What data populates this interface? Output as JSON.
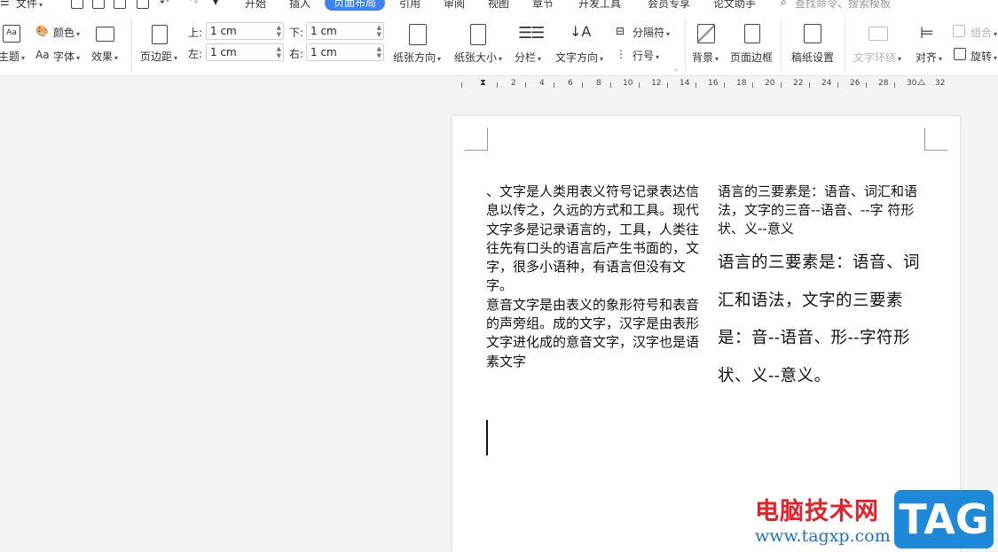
{
  "topbar": {
    "file_menu": "文件",
    "tabs": [
      "开始",
      "插入",
      "页面布局",
      "引用",
      "审阅",
      "视图",
      "章节",
      "开发工具",
      "会员专享",
      "论文助手"
    ],
    "active_tab": "页面布局",
    "search_placeholder": "查找命令、搜索模板"
  },
  "ribbon": {
    "theme": "主题",
    "color": "颜色",
    "font": "字体",
    "font_prefix": "Aa",
    "effect": "效果",
    "margin": "页边距",
    "margin_top_label": "上:",
    "margin_top_value": "1 cm",
    "margin_left_label": "左:",
    "margin_left_value": "1 cm",
    "margin_bottom_label": "下:",
    "margin_bottom_value": "1 cm",
    "margin_right_label": "右:",
    "margin_right_value": "1 cm",
    "orientation": "纸张方向",
    "size": "纸张大小",
    "columns": "分栏",
    "text_direction": "文字方向",
    "break": "分隔符",
    "line_number": "行号",
    "background": "背景",
    "page_border": "页面边框",
    "manuscript": "稿纸设置",
    "text_wrap": "文字环绕",
    "align": "对齐",
    "group": "组合",
    "rotate": "旋转"
  },
  "ruler": {
    "numbers": [
      "2",
      "4",
      "6",
      "8",
      "10",
      "12",
      "14",
      "16",
      "18",
      "20",
      "22",
      "24",
      "26",
      "28",
      "30",
      "32"
    ]
  },
  "document": {
    "col1_text": "、文字是人类用表义符号记录表达信息以传之，久远的方式和工具。现代文字多是记录语言的，工具，人类往往先有口头的语言后产生书面的，文字，很多小语种，有语言但没有文字。\n意音文字是由表义的象形符号和表音的声旁组。成的文字，汉字是由表形文字进化成的意音文字，汉字也是语素文字",
    "col2_text": "语言的三要素是：语音、词汇和语法，文字的三音--语音、--字  符形状、义--意义",
    "col2_large_text": "语言的三要素是：语音、词汇和语法，文字的三要素是：音--语音、形--字符形状、义--意义。"
  },
  "watermark": {
    "site_name": "电脑技术网",
    "url": "www.tagxp.com",
    "tag": "TAG"
  },
  "colors": {
    "accent": "#3b82f6",
    "watermark_red": "#e8202a",
    "watermark_blue": "#1e88d9"
  }
}
